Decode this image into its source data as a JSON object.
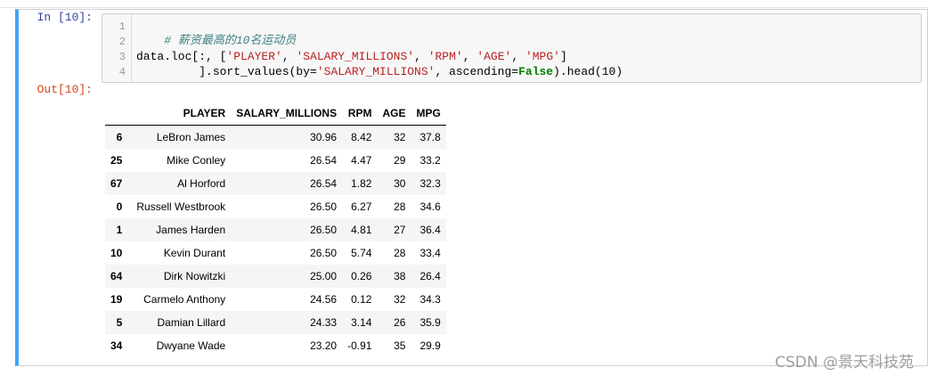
{
  "cell": {
    "in_prompt": "In  [10]:",
    "out_prompt": "Out[10]:",
    "line_numbers": [
      "1",
      "2",
      "3",
      "4"
    ],
    "code": {
      "line1_comment": "# 薪资最高的10名运动员",
      "line3_a": "data.loc[:, [",
      "line3_s1": "'PLAYER'",
      "line3_sep1": ", ",
      "line3_s2": "'SALARY_MILLIONS'",
      "line3_sep2": ", ",
      "line3_s3": "'RPM'",
      "line3_sep3": ", ",
      "line3_s4": "'AGE'",
      "line3_sep4": ", ",
      "line3_s5": "'MPG'",
      "line3_b": "]",
      "line4_a": "         ].sort_values(by=",
      "line4_s1": "'SALARY_MILLIONS'",
      "line4_b": ", ascending=",
      "line4_kw": "False",
      "line4_c": ").head(10)"
    }
  },
  "table": {
    "columns": [
      "",
      "PLAYER",
      "SALARY_MILLIONS",
      "RPM",
      "AGE",
      "MPG"
    ],
    "rows": [
      {
        "index": "6",
        "player": "LeBron James",
        "salary": "30.96",
        "rpm": "8.42",
        "age": "32",
        "mpg": "37.8"
      },
      {
        "index": "25",
        "player": "Mike Conley",
        "salary": "26.54",
        "rpm": "4.47",
        "age": "29",
        "mpg": "33.2"
      },
      {
        "index": "67",
        "player": "Al Horford",
        "salary": "26.54",
        "rpm": "1.82",
        "age": "30",
        "mpg": "32.3"
      },
      {
        "index": "0",
        "player": "Russell Westbrook",
        "salary": "26.50",
        "rpm": "6.27",
        "age": "28",
        "mpg": "34.6"
      },
      {
        "index": "1",
        "player": "James Harden",
        "salary": "26.50",
        "rpm": "4.81",
        "age": "27",
        "mpg": "36.4"
      },
      {
        "index": "10",
        "player": "Kevin Durant",
        "salary": "26.50",
        "rpm": "5.74",
        "age": "28",
        "mpg": "33.4"
      },
      {
        "index": "64",
        "player": "Dirk Nowitzki",
        "salary": "25.00",
        "rpm": "0.26",
        "age": "38",
        "mpg": "26.4"
      },
      {
        "index": "19",
        "player": "Carmelo Anthony",
        "salary": "24.56",
        "rpm": "0.12",
        "age": "32",
        "mpg": "34.3"
      },
      {
        "index": "5",
        "player": "Damian Lillard",
        "salary": "24.33",
        "rpm": "3.14",
        "age": "26",
        "mpg": "35.9"
      },
      {
        "index": "34",
        "player": "Dwyane Wade",
        "salary": "23.20",
        "rpm": "-0.91",
        "age": "35",
        "mpg": "29.9"
      }
    ]
  },
  "watermark": "CSDN @景天科技苑",
  "colors": {
    "cell_border_accent": "#42a5f5",
    "in_prompt": "#303f9f",
    "out_prompt": "#d84315",
    "string": "#ba2121",
    "keyword": "#008000",
    "comment": "#408080"
  }
}
